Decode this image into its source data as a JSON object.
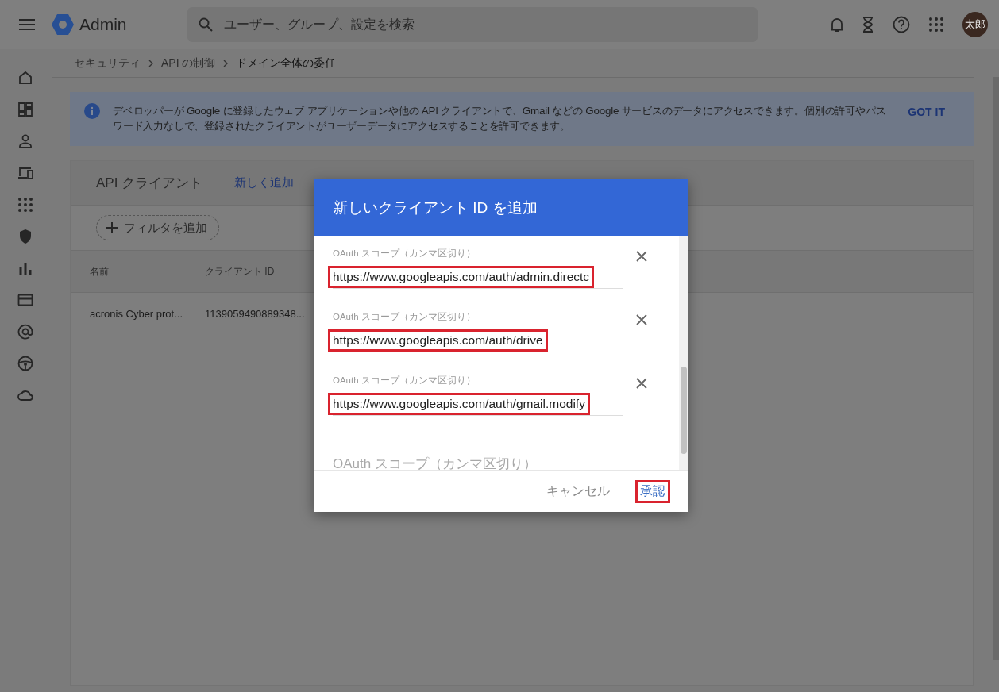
{
  "topbar": {
    "product": "Admin",
    "search": {
      "placeholder": "ユーザー、グループ、設定を検索"
    },
    "avatar": "太郎"
  },
  "sidebar": {
    "items": [
      {
        "kind": "home"
      },
      {
        "kind": "dashboard"
      },
      {
        "kind": "person"
      },
      {
        "kind": "devices"
      },
      {
        "kind": "apps"
      },
      {
        "kind": "shield"
      },
      {
        "kind": "chart"
      },
      {
        "kind": "card"
      },
      {
        "kind": "at"
      },
      {
        "kind": "wheel"
      },
      {
        "kind": "cloud"
      }
    ]
  },
  "breadcrumb": [
    "セキュリティ",
    "API の制御",
    "ドメイン全体の委任"
  ],
  "banner": {
    "text": "デベロッパーが Google に登録したウェブ アプリケーションや他の API クライアントで、Gmail などの Google サービスのデータにアクセスできます。個別の許可やパスワード入力なしで、登録されたクライアントがユーザーデータにアクセスすることを許可できます。",
    "action": "GOT IT"
  },
  "clients": {
    "title": "API クライアント",
    "actions": [
      "新しく追加"
    ],
    "filter": "フィルタを追加",
    "columns": [
      "名前",
      "クライアント ID"
    ],
    "rows": [
      [
        "acronis Cyber prot...",
        "1139059490889348..."
      ]
    ]
  },
  "dialog": {
    "title": "新しいクライアント ID を追加",
    "scopes": [
      {
        "label": "OAuth スコープ（カンマ区切り）",
        "value": "https://www.googleapis.com/auth/admin.directc",
        "highlighted": true
      },
      {
        "label": "OAuth スコープ（カンマ区切り）",
        "value": "https://www.googleapis.com/auth/drive",
        "highlighted": true
      },
      {
        "label": "OAuth スコープ（カンマ区切り）",
        "value": "https://www.googleapis.com/auth/gmail.modify",
        "highlighted": true
      }
    ],
    "new_scope": {
      "placeholder": "OAuth スコープ（カンマ区切り）"
    },
    "buttons": [
      {
        "label": "キャンセル",
        "kind": "cancel",
        "highlighted": false
      },
      {
        "label": "承認",
        "kind": "confirm",
        "highlighted": true
      }
    ]
  }
}
